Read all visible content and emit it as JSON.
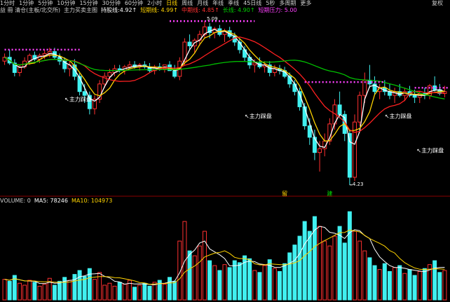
{
  "toolbar": {
    "periods": [
      "1分时",
      "1分钟",
      "5分钟",
      "10分钟",
      "15分钟",
      "30分钟",
      "60分钟",
      "2小时",
      "日线",
      "周线",
      "月线",
      "年线",
      "季线",
      "45日线",
      "5秒",
      "多周期",
      "更多"
    ],
    "active_index": 8,
    "right_label": "复权"
  },
  "main_legend": {
    "indicator_name": "益 冊 清仓(主板/北交所)",
    "formula": "主力买卖主图",
    "items": [
      {
        "text": "持股线:4.92↑",
        "color": "#ffffff"
      },
      {
        "text": "短期线: 4.99↑",
        "color": "#ffd400"
      },
      {
        "text": "中期线: 4.85↑",
        "color": "#ff3030"
      },
      {
        "text": "长线: 4.90↑",
        "color": "#00d000"
      },
      {
        "text": "短期压力: 5.00",
        "color": "#ff40ff"
      }
    ]
  },
  "annotations": [
    "主力踩盘",
    "主力踩盘",
    "主力踩盘",
    "主力踩盘"
  ],
  "peak_label": "5.09",
  "low_label": "4.23",
  "signals": [
    "留",
    "建"
  ],
  "volume_legend": {
    "name": "VOLUME: 0",
    "ma5": "MA5: 78246",
    "ma10": "MA10: 104973"
  },
  "colors": {
    "up": "#ff3030",
    "down": "#40f0f0",
    "short": "#ffd400",
    "mid": "#ff2020",
    "long": "#00c000",
    "pressure": "#ff40ff",
    "hold": "#ffffff"
  },
  "chart_data": {
    "type": "candlestick",
    "candles": [
      [
        4.88,
        4.92,
        4.86,
        4.9
      ],
      [
        4.9,
        4.94,
        4.86,
        4.87
      ],
      [
        4.87,
        4.89,
        4.8,
        4.82
      ],
      [
        4.82,
        4.86,
        4.8,
        4.85
      ],
      [
        4.85,
        4.9,
        4.84,
        4.88
      ],
      [
        4.88,
        4.92,
        4.86,
        4.91
      ],
      [
        4.91,
        4.93,
        4.88,
        4.89
      ],
      [
        4.89,
        4.92,
        4.87,
        4.91
      ],
      [
        4.91,
        4.94,
        4.89,
        4.92
      ],
      [
        4.92,
        4.95,
        4.9,
        4.93
      ],
      [
        4.93,
        4.95,
        4.89,
        4.9
      ],
      [
        4.9,
        4.92,
        4.86,
        4.88
      ],
      [
        4.88,
        4.9,
        4.82,
        4.84
      ],
      [
        4.84,
        4.88,
        4.8,
        4.86
      ],
      [
        4.86,
        4.89,
        4.78,
        4.8
      ],
      [
        4.8,
        4.82,
        4.7,
        4.72
      ],
      [
        4.72,
        4.76,
        4.66,
        4.7
      ],
      [
        4.7,
        4.72,
        4.6,
        4.63
      ],
      [
        4.63,
        4.7,
        4.6,
        4.68
      ],
      [
        4.68,
        4.78,
        4.66,
        4.76
      ],
      [
        4.76,
        4.82,
        4.74,
        4.8
      ],
      [
        4.8,
        4.84,
        4.78,
        4.82
      ],
      [
        4.82,
        4.86,
        4.8,
        4.84
      ],
      [
        4.84,
        4.86,
        4.82,
        4.83
      ],
      [
        4.83,
        4.86,
        4.81,
        4.85
      ],
      [
        4.85,
        4.88,
        4.84,
        4.86
      ],
      [
        4.86,
        4.88,
        4.84,
        4.85
      ],
      [
        4.85,
        4.87,
        4.83,
        4.86
      ],
      [
        4.86,
        4.88,
        4.84,
        4.85
      ],
      [
        4.85,
        4.87,
        4.82,
        4.83
      ],
      [
        4.83,
        4.86,
        4.81,
        4.85
      ],
      [
        4.85,
        4.87,
        4.83,
        4.84
      ],
      [
        4.84,
        4.86,
        4.82,
        4.86
      ],
      [
        4.86,
        4.88,
        4.84,
        4.83
      ],
      [
        4.83,
        4.86,
        4.79,
        4.8
      ],
      [
        4.8,
        4.9,
        4.78,
        4.88
      ],
      [
        4.88,
        5.0,
        4.86,
        4.98
      ],
      [
        4.98,
        5.02,
        4.94,
        4.96
      ],
      [
        4.96,
        5.0,
        4.92,
        4.99
      ],
      [
        4.99,
        5.04,
        4.96,
        5.02
      ],
      [
        5.02,
        5.09,
        5.0,
        5.06
      ],
      [
        5.06,
        5.08,
        5.0,
        5.03
      ],
      [
        5.03,
        5.06,
        5.0,
        5.05
      ],
      [
        5.05,
        5.07,
        5.01,
        5.02
      ],
      [
        5.02,
        5.05,
        4.98,
        5.04
      ],
      [
        5.04,
        5.06,
        5.0,
        5.01
      ],
      [
        5.01,
        5.03,
        4.96,
        4.98
      ],
      [
        4.98,
        5.0,
        4.92,
        4.94
      ],
      [
        4.94,
        4.96,
        4.88,
        4.9
      ],
      [
        4.9,
        4.92,
        4.84,
        4.86
      ],
      [
        4.86,
        4.89,
        4.82,
        4.87
      ],
      [
        4.87,
        4.9,
        4.84,
        4.85
      ],
      [
        4.85,
        4.88,
        4.82,
        4.86
      ],
      [
        4.86,
        4.88,
        4.8,
        4.82
      ],
      [
        4.82,
        4.86,
        4.8,
        4.84
      ],
      [
        4.84,
        4.86,
        4.81,
        4.83
      ],
      [
        4.83,
        4.85,
        4.79,
        4.8
      ],
      [
        4.8,
        4.82,
        4.74,
        4.76
      ],
      [
        4.76,
        4.78,
        4.7,
        4.72
      ],
      [
        4.72,
        4.74,
        4.62,
        4.64
      ],
      [
        4.64,
        4.66,
        4.52,
        4.54
      ],
      [
        4.54,
        4.58,
        4.44,
        4.48
      ],
      [
        4.48,
        4.52,
        4.36,
        4.4
      ],
      [
        4.4,
        4.46,
        4.3,
        4.42
      ],
      [
        4.42,
        4.5,
        4.38,
        4.46
      ],
      [
        4.46,
        4.58,
        4.44,
        4.55
      ],
      [
        4.55,
        4.68,
        4.52,
        4.65
      ],
      [
        4.65,
        4.72,
        4.58,
        4.6
      ],
      [
        4.6,
        4.62,
        4.46,
        4.5
      ],
      [
        4.5,
        4.52,
        4.23,
        4.27
      ],
      [
        4.27,
        4.6,
        4.25,
        4.56
      ],
      [
        4.56,
        4.72,
        4.54,
        4.7
      ],
      [
        4.7,
        4.82,
        4.66,
        4.78
      ],
      [
        4.78,
        4.86,
        4.74,
        4.76
      ],
      [
        4.76,
        4.8,
        4.7,
        4.72
      ],
      [
        4.72,
        4.76,
        4.68,
        4.74
      ],
      [
        4.74,
        4.78,
        4.7,
        4.72
      ],
      [
        4.72,
        4.76,
        4.68,
        4.7
      ],
      [
        4.7,
        4.74,
        4.66,
        4.72
      ],
      [
        4.72,
        4.76,
        4.69,
        4.7
      ],
      [
        4.7,
        4.74,
        4.67,
        4.72
      ],
      [
        4.72,
        4.75,
        4.69,
        4.7
      ],
      [
        4.7,
        4.73,
        4.66,
        4.69
      ],
      [
        4.69,
        4.72,
        4.66,
        4.71
      ],
      [
        4.71,
        4.74,
        4.68,
        4.7
      ],
      [
        4.7,
        4.76,
        4.68,
        4.75
      ],
      [
        4.75,
        4.8,
        4.72,
        4.73
      ],
      [
        4.73,
        4.76,
        4.7,
        4.71
      ],
      [
        4.71,
        4.75,
        4.69,
        4.72
      ]
    ],
    "volumes": [
      42,
      38,
      50,
      34,
      30,
      40,
      36,
      28,
      32,
      44,
      30,
      38,
      46,
      40,
      52,
      60,
      48,
      64,
      42,
      56,
      30,
      34,
      28,
      36,
      32,
      40,
      26,
      30,
      34,
      28,
      36,
      40,
      32,
      46,
      38,
      120,
      160,
      100,
      90,
      110,
      140,
      80,
      70,
      60,
      72,
      66,
      80,
      76,
      90,
      84,
      60,
      56,
      70,
      82,
      64,
      58,
      74,
      96,
      112,
      130,
      160,
      140,
      170,
      150,
      120,
      110,
      130,
      150,
      116,
      180,
      140,
      120,
      100,
      86,
      70,
      62,
      74,
      58,
      66,
      70,
      54,
      62,
      50,
      58,
      64,
      72,
      80,
      56,
      60
    ],
    "up_flags": [
      1,
      0,
      0,
      1,
      1,
      1,
      0,
      1,
      1,
      1,
      0,
      0,
      0,
      1,
      0,
      0,
      0,
      0,
      1,
      1,
      1,
      1,
      1,
      0,
      1,
      1,
      0,
      1,
      0,
      0,
      1,
      0,
      1,
      0,
      0,
      1,
      1,
      0,
      1,
      1,
      1,
      0,
      1,
      0,
      1,
      0,
      0,
      0,
      0,
      0,
      1,
      0,
      1,
      0,
      1,
      0,
      0,
      0,
      0,
      0,
      0,
      0,
      0,
      1,
      1,
      1,
      1,
      0,
      0,
      0,
      1,
      1,
      1,
      0,
      0,
      1,
      0,
      0,
      1,
      0,
      1,
      0,
      0,
      1,
      0,
      1,
      0,
      0,
      1
    ],
    "pressure_segments": [
      [
        0,
        15,
        4.94
      ],
      [
        33,
        50,
        5.09
      ],
      [
        60,
        76,
        4.77
      ],
      [
        82,
        89,
        4.74
      ]
    ],
    "ylim": [
      4.2,
      5.12
    ]
  }
}
